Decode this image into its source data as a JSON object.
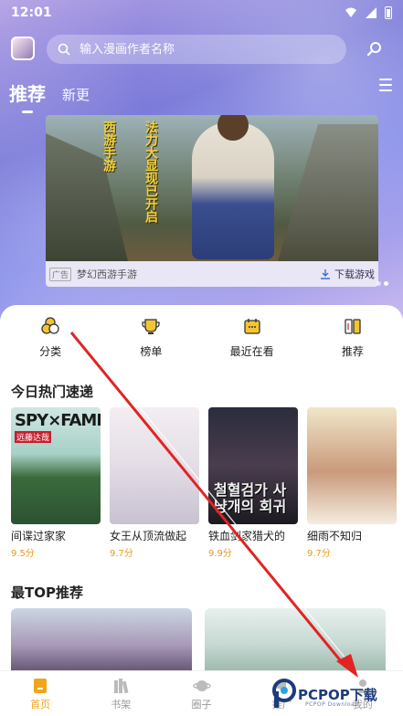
{
  "status_bar": {
    "time": "12:01"
  },
  "search": {
    "placeholder": "输入漫画作者名称"
  },
  "tabs": [
    {
      "label": "推荐"
    },
    {
      "label": "新更"
    }
  ],
  "banner": {
    "calligraphy_line1": "西游手游",
    "calligraphy_line2": "法力大显现已开启",
    "ad_label": "广告",
    "title": "梦幻西游手游",
    "action": "下载游戏"
  },
  "quick_nav": [
    {
      "label": "分类",
      "icon": "category-icon"
    },
    {
      "label": "榜单",
      "icon": "ranking-icon"
    },
    {
      "label": "最近在看",
      "icon": "recent-icon"
    },
    {
      "label": "推荐",
      "icon": "recommend-icon"
    }
  ],
  "sections": {
    "hot_today": "今日热门速递",
    "top_recommend": "最TOP推荐"
  },
  "comics": [
    {
      "name": "间谍过家家",
      "score": "9.5分",
      "cover_title": "SPY×FAMILY",
      "cover_sub": "远藤达哉"
    },
    {
      "name": "女王从顶流做起",
      "score": "9.7分"
    },
    {
      "name": "铁血剑家猎犬的",
      "score": "9.9分",
      "cover_title": "철혈검가 사냥개의 회귀"
    },
    {
      "name": "细雨不知归",
      "score": "9.7分"
    }
  ],
  "bottom_nav": [
    {
      "label": "首页",
      "icon": "home-icon"
    },
    {
      "label": "书架",
      "icon": "bookshelf-icon"
    },
    {
      "label": "圈子",
      "icon": "circle-icon"
    },
    {
      "label": "推广",
      "icon": "promote-icon"
    },
    {
      "label": "我的",
      "icon": "profile-icon"
    }
  ],
  "watermark": {
    "brand": "PCPOP下载",
    "sub": "PCPOP Download"
  },
  "colors": {
    "accent": "#f0a51b",
    "score": "#e99a1f",
    "annotation_arrow": "#e02424"
  }
}
